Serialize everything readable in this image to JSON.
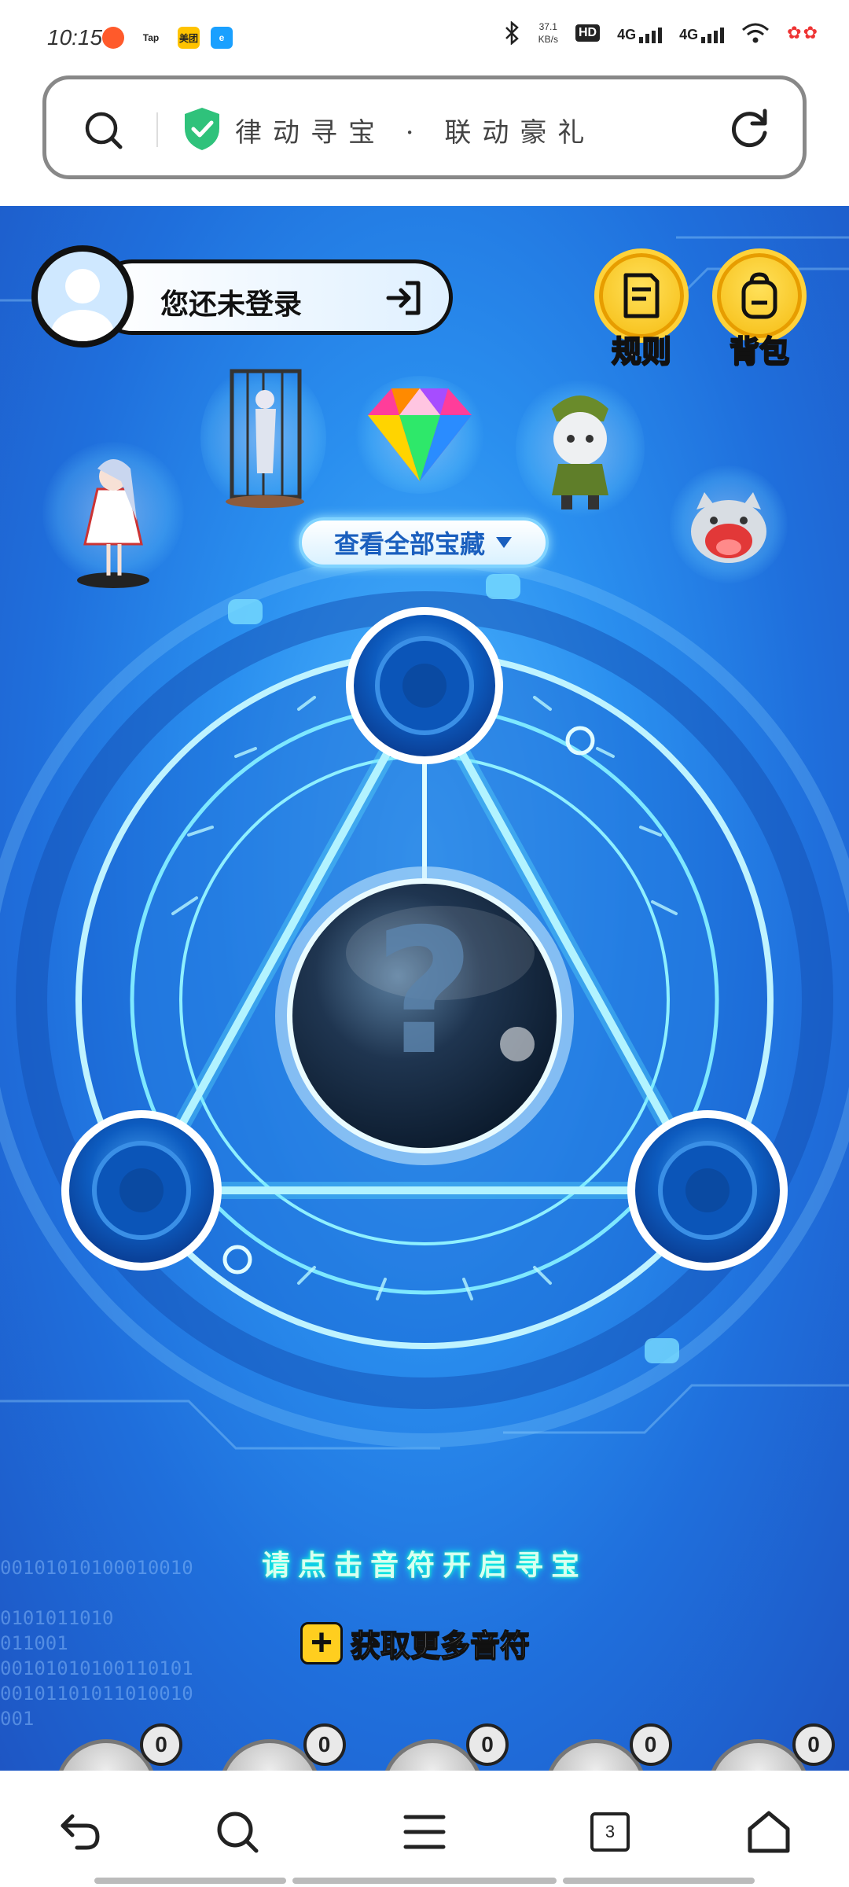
{
  "status_bar": {
    "time": "10:15",
    "app_icons": [
      "Tap",
      "美团"
    ],
    "network_speed": "37.1",
    "network_unit": "KB/s",
    "hd_label": "HD",
    "net_1": "4G",
    "net_2": "4G"
  },
  "address_bar": {
    "page_title": "律动寻宝 · 联动豪礼",
    "icons": [
      "search-icon",
      "shield-check-icon",
      "reload-icon"
    ]
  },
  "game": {
    "login_label": "您还未登录",
    "rules_label": "规则",
    "backpack_label": "背包",
    "view_all_label": "查看全部宝藏",
    "mystery_symbol": "?",
    "hint_text": "请点击音符开启寻宝",
    "get_more_label": "获取更多音符",
    "binary_lines": [
      "00101010100010010",
      "0101011010",
      "011001",
      "00101010100110101",
      "00101101011010010",
      "001"
    ],
    "notes": [
      {
        "count": "0"
      },
      {
        "count": "0"
      },
      {
        "count": "0"
      },
      {
        "count": "0"
      },
      {
        "count": "0"
      }
    ],
    "colors": {
      "background": "#2a8fef",
      "accent_gold": "#f5b90c",
      "glow": "#9ee7ff"
    }
  },
  "bottom_nav": {
    "tab_count": "3",
    "icons": [
      "back-icon",
      "search-icon",
      "menu-icon",
      "tabs-icon",
      "home-icon"
    ]
  }
}
